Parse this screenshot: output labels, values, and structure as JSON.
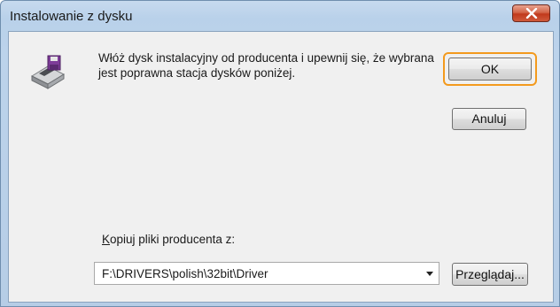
{
  "window": {
    "title": "Instalowanie z dysku",
    "close_icon": "close-icon"
  },
  "dialog": {
    "icon": "floppy-disk-drive-icon",
    "message": "Włóż dysk instalacyjny od producenta i upewnij się, że wybrana jest poprawna stacja dysków poniżej.",
    "ok_label": "OK",
    "cancel_label": "Anuluj",
    "copy_label": {
      "mnemonic": "K",
      "rest": "opiuj pliki producenta z:"
    },
    "path_value": "F:\\DRIVERS\\polish\\32bit\\Driver",
    "browse_label": "Przeglądaj..."
  },
  "colors": {
    "focus_ring": "#f39a1e",
    "close_button": "#c1391c",
    "title_bar": "#b9d1ea",
    "client_background": "#f0f0f0"
  }
}
